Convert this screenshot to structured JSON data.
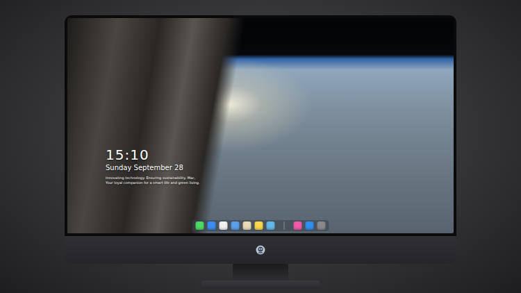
{
  "clock": {
    "time": "15:10",
    "date": "Sunday September 28",
    "tagline": [
      "Innovating technology. Ensuring sustainability. Mac,",
      "Your loyal companion for a smart life and green living."
    ]
  },
  "dock": {
    "items": [
      {
        "kind": "app",
        "color": "#4cd964"
      },
      {
        "kind": "app",
        "color": "#3b8cf0"
      },
      {
        "kind": "app",
        "color": "#f2f2f2"
      },
      {
        "kind": "app",
        "color": "#5aa0e8"
      },
      {
        "kind": "app",
        "color": "#e8dcb8"
      },
      {
        "kind": "app",
        "color": "#f8d84a"
      },
      {
        "kind": "app",
        "color": "#62b8e8"
      },
      {
        "kind": "separator"
      },
      {
        "kind": "app",
        "color": "#f05aa8"
      },
      {
        "kind": "app",
        "color": "#2e8ff0"
      },
      {
        "kind": "app",
        "color": "#8a8a8e"
      }
    ]
  }
}
